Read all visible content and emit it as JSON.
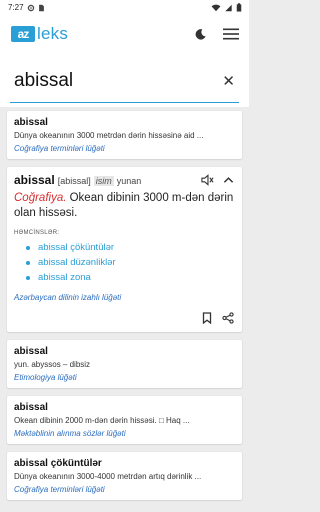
{
  "status": {
    "time": "7:27"
  },
  "app": {
    "logo_mark": "az",
    "logo_text": "leks"
  },
  "search": {
    "value": "abissal",
    "clear": "✕"
  },
  "results": [
    {
      "title": "abissal",
      "text": "Dünya okeanının 3000 metrdən dərin hissəsinə aid ...",
      "source": "Coğrafiya terminləri lüğəti"
    },
    {
      "title": "abissal",
      "text": "yun. abyssos – dibsiz",
      "source": "Etimologiya lüğəti"
    },
    {
      "title": "abissal",
      "text": "Okean dibinin 2000 m-dən dərin hissəsi. □ Haq ...",
      "source": "Məktəblinin alınma sözlər lüğəti"
    },
    {
      "title": "abissal çöküntülər",
      "text": "Dünya okeanının 3000-4000 metrdən artıq dərinlik ...",
      "source": "Coğrafiya terminləri lüğəti"
    }
  ],
  "expanded": {
    "word": "abissal",
    "transcription": "[abissal]",
    "pos": "isim",
    "origin": "yunan",
    "category": "Coğrafiya.",
    "definition": " Okean dibinin 3000 m-dən dərin olan hissəsi.",
    "synonyms_label": "HƏMCİNSLƏR:",
    "synonyms": [
      "abissal çöküntülər",
      "abissal düzənliklər",
      "abissal zona"
    ],
    "source": "Azərbaycan dilinin izahlı lüğəti"
  },
  "colors": {
    "accent": "#2a9fd6",
    "link": "#2a6cc0",
    "category": "#d32f2f"
  }
}
